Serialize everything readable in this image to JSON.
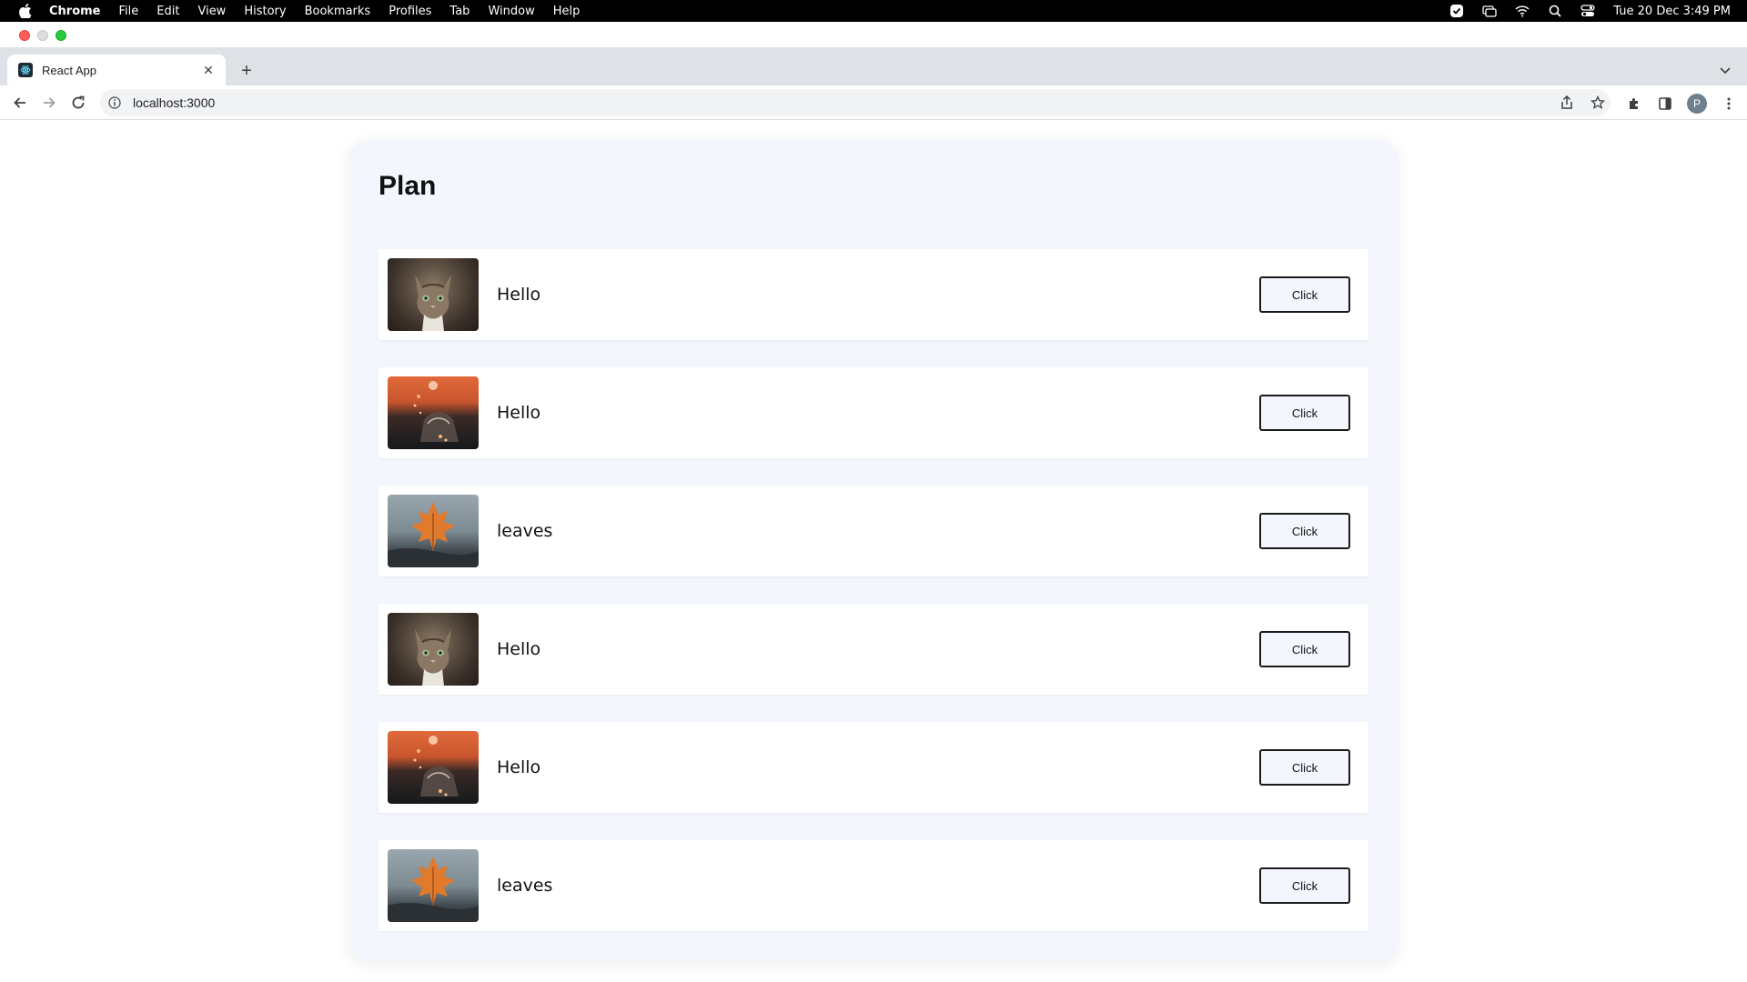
{
  "menubar": {
    "app_name": "Chrome",
    "items": [
      "File",
      "Edit",
      "View",
      "History",
      "Bookmarks",
      "Profiles",
      "Tab",
      "Window",
      "Help"
    ],
    "clock": "Tue 20 Dec  3:49 PM"
  },
  "browser": {
    "tab_title": "React App",
    "url": "localhost:3000",
    "profile_initial": "P"
  },
  "page": {
    "heading": "Plan",
    "items": [
      {
        "label": "Hello",
        "image": "cat-photo",
        "button": "Click"
      },
      {
        "label": "Hello",
        "image": "sunset-jar-photo",
        "button": "Click"
      },
      {
        "label": "leaves",
        "image": "autumn-leaf-photo",
        "button": "Click"
      },
      {
        "label": "Hello",
        "image": "cat-photo",
        "button": "Click"
      },
      {
        "label": "Hello",
        "image": "sunset-jar-photo",
        "button": "Click"
      },
      {
        "label": "leaves",
        "image": "autumn-leaf-photo",
        "button": "Click"
      }
    ]
  },
  "colors": {
    "card_background": "#f3f7fd",
    "row_background": "#ffffff",
    "button_border": "#1a1a1a"
  }
}
